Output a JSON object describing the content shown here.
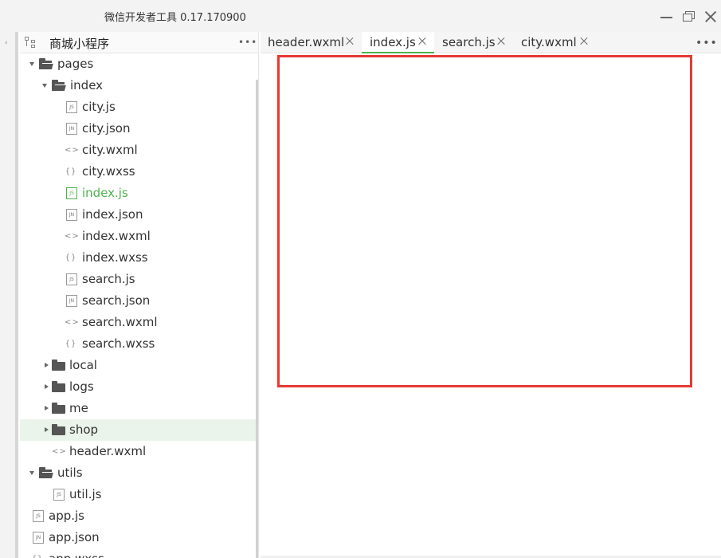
{
  "window": {
    "title": "微信开发者工具 0.17.170900"
  },
  "sidebar": {
    "title": "商城小程序",
    "tree": [
      {
        "label": "pages",
        "type": "folder",
        "expanded": true,
        "active": false
      },
      {
        "label": "index",
        "type": "folder",
        "expanded": true,
        "active": false
      },
      {
        "label": "city.js",
        "type": "js",
        "icon": "JS"
      },
      {
        "label": "city.json",
        "type": "json",
        "icon": "JN"
      },
      {
        "label": "city.wxml",
        "type": "wxml",
        "icon": "<>"
      },
      {
        "label": "city.wxss",
        "type": "wxss",
        "icon": "{}"
      },
      {
        "label": "index.js",
        "type": "js",
        "icon": "JS",
        "active": true
      },
      {
        "label": "index.json",
        "type": "json",
        "icon": "JN"
      },
      {
        "label": "index.wxml",
        "type": "wxml",
        "icon": "<>"
      },
      {
        "label": "index.wxss",
        "type": "wxss",
        "icon": "{}"
      },
      {
        "label": "search.js",
        "type": "js",
        "icon": "JS"
      },
      {
        "label": "search.json",
        "type": "json",
        "icon": "JN"
      },
      {
        "label": "search.wxml",
        "type": "wxml",
        "icon": "<>"
      },
      {
        "label": "search.wxss",
        "type": "wxss",
        "icon": "{}"
      },
      {
        "label": "local",
        "type": "folder",
        "expanded": false
      },
      {
        "label": "logs",
        "type": "folder",
        "expanded": false
      },
      {
        "label": "me",
        "type": "folder",
        "expanded": false
      },
      {
        "label": "shop",
        "type": "folder",
        "expanded": false,
        "highlighted": true
      },
      {
        "label": "header.wxml",
        "type": "wxml",
        "icon": "<>"
      },
      {
        "label": "utils",
        "type": "folder",
        "expanded": true
      },
      {
        "label": "util.js",
        "type": "js",
        "icon": "JS"
      },
      {
        "label": "app.js",
        "type": "js",
        "icon": "JS"
      },
      {
        "label": "app.json",
        "type": "json",
        "icon": "JN"
      },
      {
        "label": "app.wxss",
        "type": "wxss",
        "icon": "{}"
      }
    ]
  },
  "tabs": [
    {
      "label": "header.wxml",
      "active": false
    },
    {
      "label": "index.js",
      "active": true
    },
    {
      "label": "search.js",
      "active": false
    },
    {
      "label": "city.wxml",
      "active": false
    }
  ],
  "colors": {
    "accent": "#4cb34c",
    "highlight_box": "#e53935",
    "highlight_row": "#eaf4ea"
  }
}
